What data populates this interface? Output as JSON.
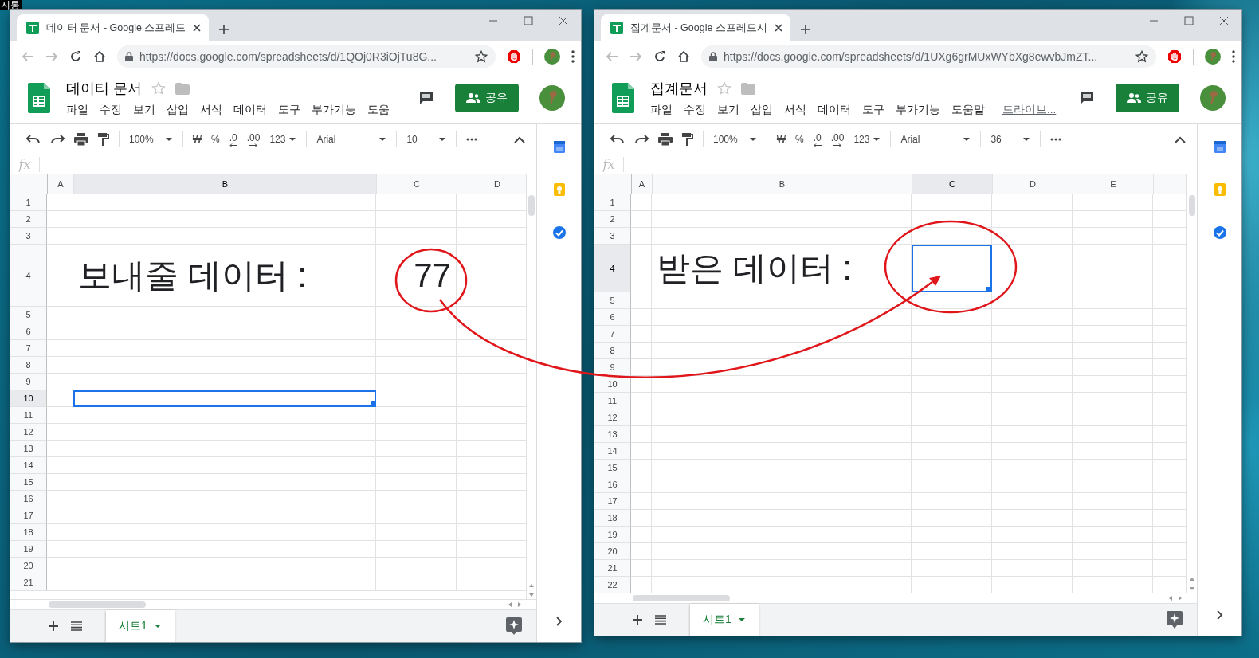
{
  "desktop": {
    "icon_label": "지통"
  },
  "windows": [
    {
      "tab_title": "데이터 문서 - Google 스프레드",
      "url": "https://docs.google.com/spreadsheets/d/1QOj0R3iOjTu8G...",
      "doc_title": "데이터 문서",
      "menus": [
        {
          "label": "파일",
          "kind": "menu"
        },
        {
          "label": "수정",
          "kind": "menu"
        },
        {
          "label": "보기",
          "kind": "menu"
        },
        {
          "label": "삽입",
          "kind": "menu"
        },
        {
          "label": "서식",
          "kind": "menu"
        },
        {
          "label": "데이터",
          "kind": "menu"
        },
        {
          "label": "도구",
          "kind": "menu"
        },
        {
          "label": "부가기능",
          "kind": "menu"
        },
        {
          "label": "도움",
          "kind": "menu"
        }
      ],
      "share_label": "공유",
      "zoom": "100%",
      "currency": "₩",
      "percent": "%",
      "decrease_decimals": ".0",
      "increase_decimals": ".00",
      "number_format": "123",
      "font": "Arial",
      "font_size": "10",
      "formula_label": "fx",
      "columns": [
        {
          "label": "A",
          "selected": false
        },
        {
          "label": "B",
          "selected": true
        },
        {
          "label": "C",
          "selected": false
        },
        {
          "label": "D",
          "selected": false
        }
      ],
      "rows": [
        {
          "label": "1",
          "selected": false
        },
        {
          "label": "2",
          "selected": false
        },
        {
          "label": "3",
          "selected": false
        },
        {
          "label": "4",
          "selected": false,
          "cells": {
            "column_b": {
              "text": "보내줄 데이터 :",
              "kind": "text",
              "active": false
            },
            "column_c": {
              "text": "77",
              "kind": "number",
              "active": false
            }
          }
        },
        {
          "label": "5",
          "selected": false
        },
        {
          "label": "6",
          "selected": false
        },
        {
          "label": "7",
          "selected": false
        },
        {
          "label": "8",
          "selected": false
        },
        {
          "label": "9",
          "selected": false
        },
        {
          "label": "10",
          "selected": true,
          "cells": {
            "column_b": {
              "active": true
            }
          }
        },
        {
          "label": "11",
          "selected": false
        },
        {
          "label": "12",
          "selected": false
        },
        {
          "label": "13",
          "selected": false
        },
        {
          "label": "14",
          "selected": false
        },
        {
          "label": "15",
          "selected": false
        },
        {
          "label": "16",
          "selected": false
        },
        {
          "label": "17",
          "selected": false
        },
        {
          "label": "18",
          "selected": false
        },
        {
          "label": "19",
          "selected": false
        },
        {
          "label": "20",
          "selected": false
        },
        {
          "label": "21",
          "selected": false
        }
      ],
      "sheet_tab": {
        "label": "시트1",
        "selected": true
      }
    },
    {
      "tab_title": "집계문서 - Google 스프레드시",
      "url": "https://docs.google.com/spreadsheets/d/1UXg6grMUxWYbXg8ewvbJmZT...",
      "doc_title": "집계문서",
      "menus": [
        {
          "label": "파일",
          "kind": "menu"
        },
        {
          "label": "수정",
          "kind": "menu"
        },
        {
          "label": "보기",
          "kind": "menu"
        },
        {
          "label": "삽입",
          "kind": "menu"
        },
        {
          "label": "서식",
          "kind": "menu"
        },
        {
          "label": "데이터",
          "kind": "menu"
        },
        {
          "label": "도구",
          "kind": "menu"
        },
        {
          "label": "부가기능",
          "kind": "menu"
        },
        {
          "label": "도움말",
          "kind": "menu"
        },
        {
          "label": "드라이브...",
          "kind": "link"
        }
      ],
      "share_label": "공유",
      "zoom": "100%",
      "currency": "₩",
      "percent": "%",
      "decrease_decimals": ".0",
      "increase_decimals": ".00",
      "number_format": "123",
      "font": "Arial",
      "font_size": "36",
      "formula_label": "fx",
      "columns": [
        {
          "label": "A",
          "selected": false
        },
        {
          "label": "B",
          "selected": false
        },
        {
          "label": "C",
          "selected": true
        },
        {
          "label": "D",
          "selected": false
        },
        {
          "label": "E",
          "selected": false
        }
      ],
      "rows": [
        {
          "label": "1",
          "selected": false
        },
        {
          "label": "2",
          "selected": false
        },
        {
          "label": "3",
          "selected": false
        },
        {
          "label": "4",
          "selected": true,
          "cells": {
            "column_b": {
              "text": "받은 데이터 :",
              "kind": "text",
              "active": false
            },
            "column_c": {
              "active": true
            }
          }
        },
        {
          "label": "5",
          "selected": false
        },
        {
          "label": "6",
          "selected": false
        },
        {
          "label": "7",
          "selected": false
        },
        {
          "label": "8",
          "selected": false
        },
        {
          "label": "9",
          "selected": false
        },
        {
          "label": "10",
          "selected": false
        },
        {
          "label": "11",
          "selected": false
        },
        {
          "label": "12",
          "selected": false
        },
        {
          "label": "13",
          "selected": false
        },
        {
          "label": "14",
          "selected": false
        },
        {
          "label": "15",
          "selected": false
        },
        {
          "label": "16",
          "selected": false
        },
        {
          "label": "17",
          "selected": false
        },
        {
          "label": "18",
          "selected": false
        },
        {
          "label": "19",
          "selected": false
        },
        {
          "label": "20",
          "selected": false
        },
        {
          "label": "21",
          "selected": false
        },
        {
          "label": "22",
          "selected": false
        }
      ],
      "sheet_tab": {
        "label": "시트1",
        "selected": true
      }
    }
  ]
}
